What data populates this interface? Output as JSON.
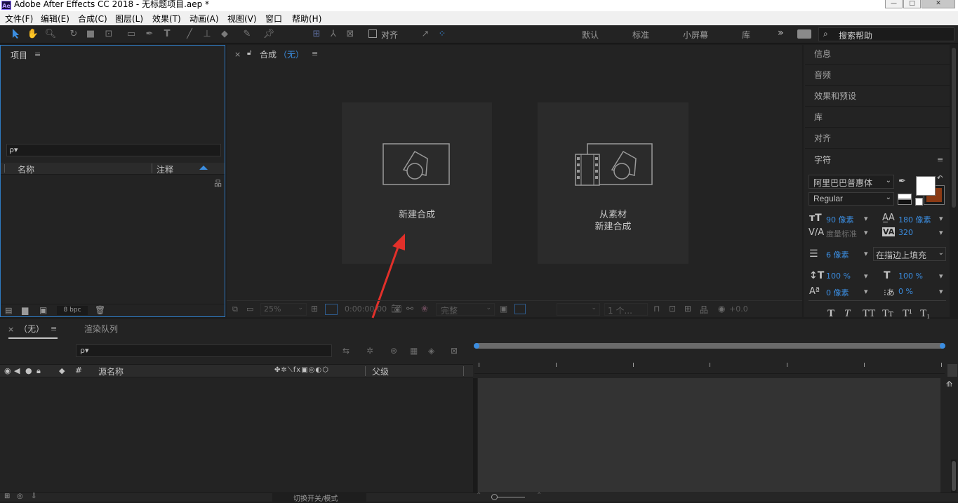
{
  "window": {
    "app_badge": "Ae",
    "title": "Adobe After Effects CC 2018 - 无标题项目.aep *",
    "minimize": "—",
    "maximize": "□",
    "close": "✕"
  },
  "menu": [
    "文件(F)",
    "编辑(E)",
    "合成(C)",
    "图层(L)",
    "效果(T)",
    "动画(A)",
    "视图(V)",
    "窗口",
    "帮助(H)"
  ],
  "toolbar": {
    "snap_label": "对齐",
    "workspaces": [
      "默认",
      "标准",
      "小屏幕",
      "库"
    ],
    "more": "»",
    "search_placeholder": "搜索帮助"
  },
  "project": {
    "title": "项目",
    "menu_icon": "≡",
    "search_placeholder": "ρ▾",
    "col_name": "名称",
    "col_comment": "注释",
    "bpc": "8 bpc"
  },
  "composition": {
    "close": "×",
    "title": "合成",
    "name": "（无）",
    "menu_icon": "≡",
    "card1_label": "新建合成",
    "card2_line1": "从素材",
    "card2_line2": "新建合成",
    "zoom": "25%",
    "timecode": "0:00:00:00",
    "quality": "完整",
    "view": "1 个...",
    "exposure": "+0.0"
  },
  "right_panels": [
    "信息",
    "音频",
    "效果和预设",
    "库",
    "对齐"
  ],
  "character": {
    "title": "字符",
    "menu_icon": "≡",
    "font": "阿里巴巴普惠体",
    "style": "Regular",
    "font_size": "90 像素",
    "leading": "180 像素",
    "kerning": "度量标准",
    "tracking": "320",
    "stroke_width": "6 像素",
    "stroke_type": "在描边上填充",
    "vscale": "100 %",
    "hscale": "100 %",
    "baseline": "0 像素",
    "tsume": "0 %",
    "styles": [
      "T",
      "T",
      "TT",
      "Tт",
      "T¹",
      "T₁"
    ],
    "fill_color": "#ffffff",
    "stroke_color": "#8b3a14"
  },
  "timeline": {
    "close": "×",
    "tab_none": "（无）",
    "menu_icon": "≡",
    "tab_render": "渲染队列",
    "search_placeholder": "ρ▾",
    "hash": "#",
    "col_source": "源名称",
    "col_parent": "父级",
    "switch_label": "切换开关/模式"
  }
}
